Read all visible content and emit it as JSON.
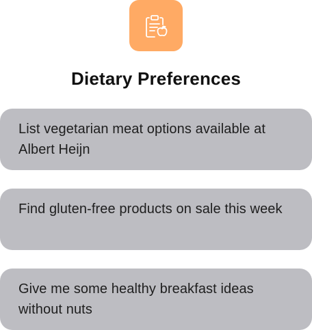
{
  "header": {
    "icon": "clipboard-apple-icon",
    "title": "Dietary Preferences",
    "accent_color": "#FFAA64"
  },
  "suggestions": [
    {
      "text": "List vegetarian meat options available at Albert Heijn"
    },
    {
      "text": "Find gluten-free products on sale this week"
    },
    {
      "text": "Give me some healthy breakfast ideas without nuts"
    }
  ],
  "colors": {
    "card_background": "#BDBDC2",
    "title_text": "#111111",
    "card_text": "#1E1E1E"
  }
}
